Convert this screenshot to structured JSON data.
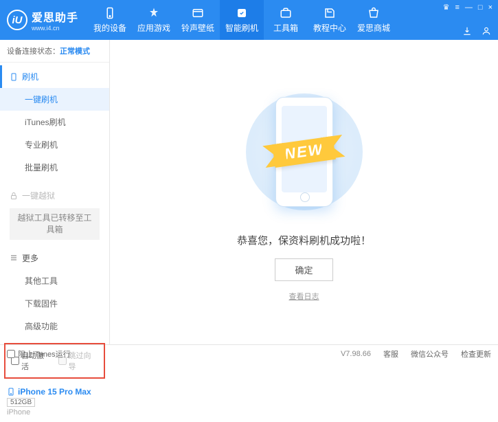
{
  "brand": {
    "name": "爱思助手",
    "sub": "www.i4.cn",
    "logo_glyph": "iU"
  },
  "topnav": [
    {
      "label": "我的设备"
    },
    {
      "label": "应用游戏"
    },
    {
      "label": "铃声壁纸"
    },
    {
      "label": "智能刷机",
      "active": true
    },
    {
      "label": "工具箱"
    },
    {
      "label": "教程中心"
    },
    {
      "label": "爱思商城"
    }
  ],
  "device_status": {
    "prefix": "设备连接状态：",
    "mode": "正常模式"
  },
  "sidebar": {
    "flash": {
      "header": "刷机",
      "items": [
        "一键刷机",
        "iTunes刷机",
        "专业刷机",
        "批量刷机"
      ],
      "active_index": 0
    },
    "jailbreak": {
      "header": "一键越狱",
      "note": "越狱工具已转移至工具箱"
    },
    "more": {
      "header": "更多",
      "items": [
        "其他工具",
        "下载固件",
        "高级功能"
      ]
    }
  },
  "checkboxes": {
    "auto_activate": "自动激活",
    "skip_setup": "跳过向导"
  },
  "device": {
    "name": "iPhone 15 Pro Max",
    "storage": "512GB",
    "platform": "iPhone"
  },
  "main": {
    "ribbon": "NEW",
    "success_text": "恭喜您，保资料刷机成功啦！",
    "ok_button": "确定",
    "view_log": "查看日志"
  },
  "statusbar": {
    "block_itunes": "阻止iTunes运行",
    "version": "V7.98.66",
    "customer_service": "客服",
    "wechat": "微信公众号",
    "check_update": "检查更新"
  },
  "window_controls": {
    "menu": "≡",
    "min": "—",
    "max": "□",
    "close": "×"
  }
}
